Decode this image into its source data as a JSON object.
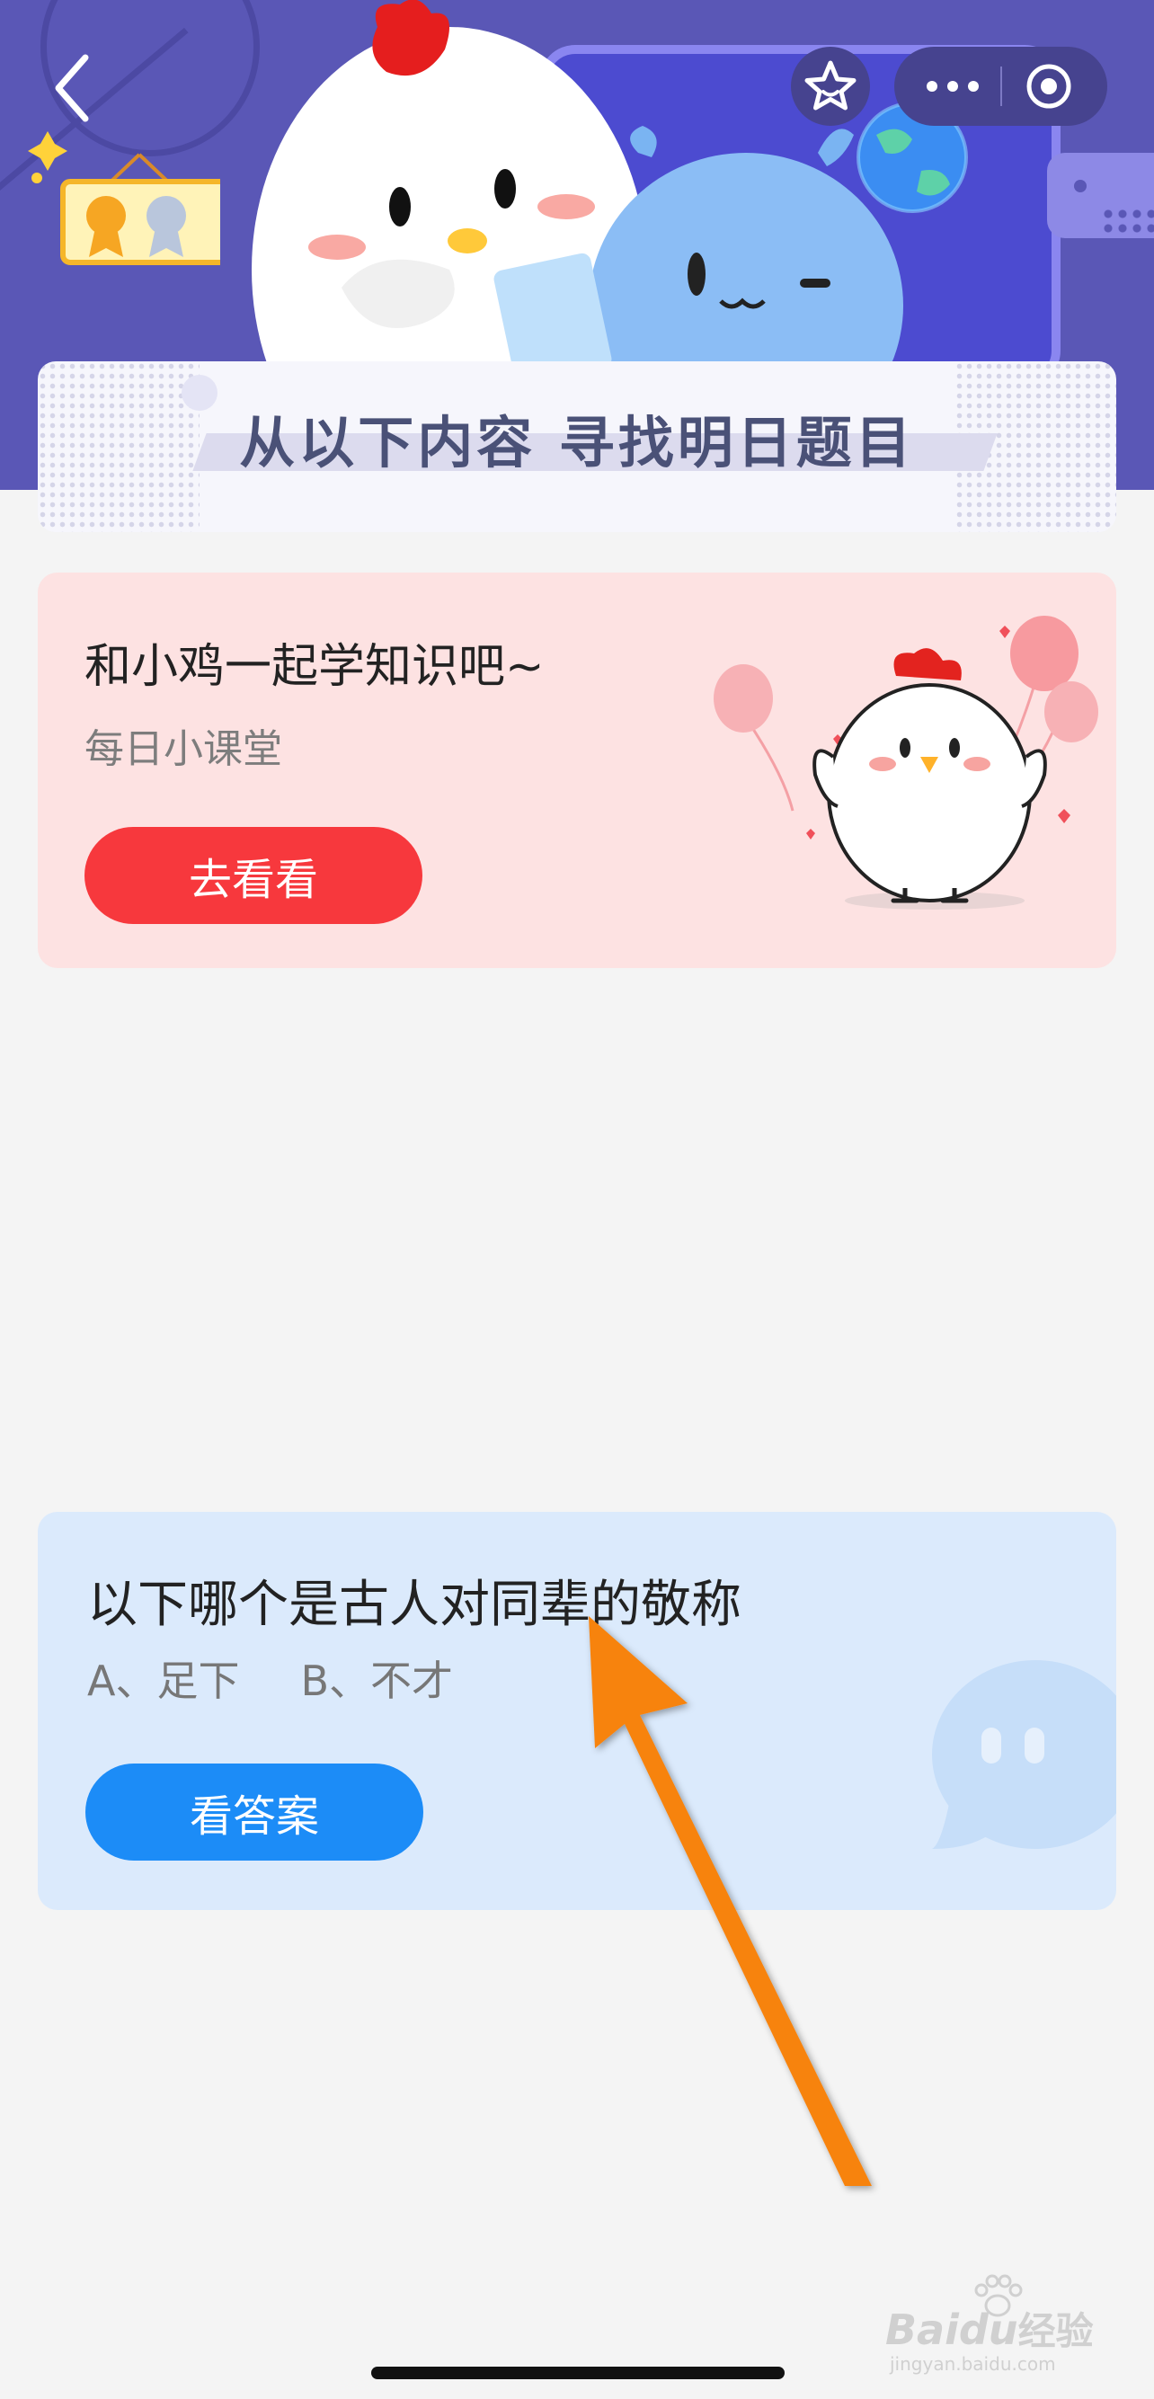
{
  "header": {
    "back_icon": "chevron-left-icon",
    "favorite_icon": "star-icon",
    "more_icon": "more-dots-icon",
    "close_icon": "target-circle-icon",
    "banner_title": "从以下内容  寻找明日题目"
  },
  "lesson_card": {
    "title": "和小鸡一起学知识吧~",
    "subtitle": "每日小课堂",
    "button_label": "去看看"
  },
  "question_card": {
    "question": "以下哪个是古人对同辈的敬称",
    "options": [
      "A、足下",
      "B、不才"
    ],
    "button_label": "看答案"
  },
  "watermark": {
    "brand": "Bai",
    "brand_suffix": "du",
    "tail": "经验",
    "url": "jingyan.baidu.com"
  },
  "colors": {
    "hero": "#5a57b6",
    "pink_card": "#fde2e2",
    "blue_card": "#dbeafc",
    "red_button": "#f7383d",
    "blue_button": "#1c8cf7",
    "arrow": "#f7830f"
  }
}
